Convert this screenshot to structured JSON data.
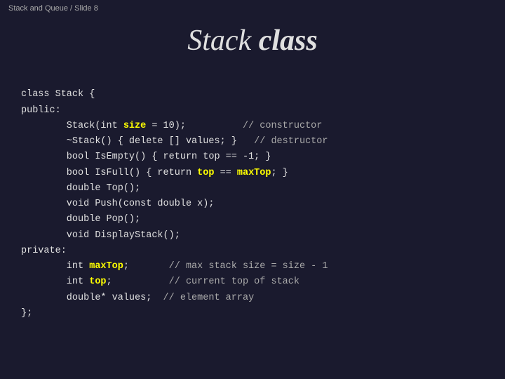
{
  "breadcrumb": "Stack and Queue / Slide 8",
  "title": {
    "part1": "Stack",
    "part2": "class"
  },
  "code": {
    "lines": [
      {
        "type": "normal",
        "text": "class Stack {"
      },
      {
        "type": "normal",
        "text": "public:"
      },
      {
        "type": "constructor",
        "text": "        Stack(int size = 10);",
        "comment": "// constructor"
      },
      {
        "type": "destructor",
        "text": "        ~Stack() { delete [] values; }",
        "comment": "// destructor"
      },
      {
        "type": "normal",
        "text": "        bool IsEmpty() { return top == -1; }"
      },
      {
        "type": "isFull",
        "text": "        bool IsFull() { return top == maxTop; }"
      },
      {
        "type": "normal",
        "text": "        double Top();"
      },
      {
        "type": "normal",
        "text": "        void Push(const double x);"
      },
      {
        "type": "normal",
        "text": "        double Pop();"
      },
      {
        "type": "normal",
        "text": "        void DisplayStack();"
      },
      {
        "type": "normal",
        "text": "private:"
      },
      {
        "type": "maxTop",
        "text": "        int maxTop;",
        "comment": "// max stack size = size - 1"
      },
      {
        "type": "top",
        "text": "        int top;",
        "comment": "// current top of stack"
      },
      {
        "type": "normal",
        "text": "        double* values;",
        "comment": "// element array"
      },
      {
        "type": "normal",
        "text": "};"
      }
    ]
  }
}
